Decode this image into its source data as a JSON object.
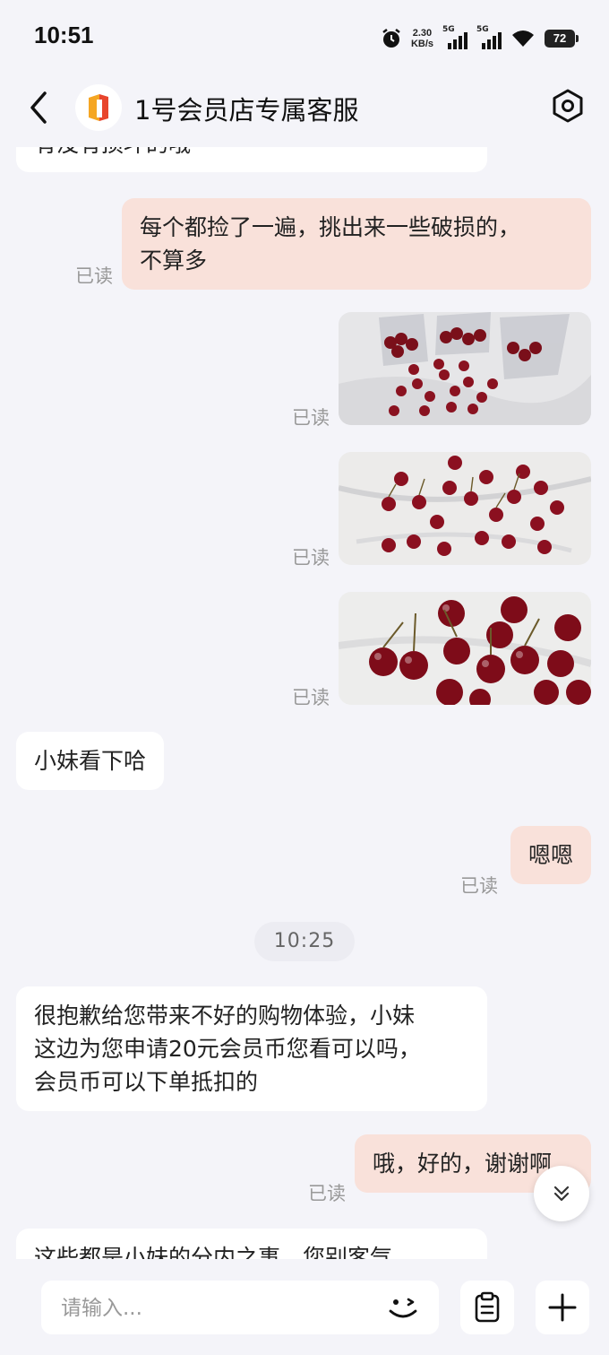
{
  "status_bar": {
    "time": "10:51",
    "net_speed_value": "2.30",
    "net_speed_unit": "KB/s",
    "sim1": "5G",
    "sim2": "5G",
    "battery": "72"
  },
  "header": {
    "title": "1号会员店专属客服"
  },
  "messages": [
    {
      "side": "in",
      "text": "有没有损坏的哦"
    },
    {
      "side": "out",
      "text_line1": "每个都捡了一遍，挑出来一些破损的，",
      "text_line2": "不算多",
      "status": "已读"
    },
    {
      "side": "out",
      "type": "image",
      "content": "cherries with plastic bags",
      "status": "已读"
    },
    {
      "side": "out",
      "type": "image",
      "content": "cherries on marble",
      "status": "已读"
    },
    {
      "side": "out",
      "type": "image",
      "content": "cherries close-up",
      "status": "已读"
    },
    {
      "side": "in",
      "text": "小妹看下哈"
    },
    {
      "side": "out",
      "text": "嗯嗯",
      "status": "已读"
    },
    {
      "type": "timestamp",
      "text": "10:25"
    },
    {
      "side": "in",
      "text_line1": "很抱歉给您带来不好的购物体验，小妹",
      "text_line2": "这边为您申请20元会员币您看可以吗，",
      "text_line3": "会员币可以下单抵扣的"
    },
    {
      "side": "out",
      "text": "哦，好的，谢谢啊",
      "status": "已读"
    },
    {
      "side": "in",
      "text": "这些都是小妹的分内之事，您别客气"
    }
  ],
  "input": {
    "placeholder": "请输入..."
  },
  "icons": {
    "back": "chevron-left-icon",
    "settings": "hexagon-gear-icon",
    "emoji": "wink-face-icon",
    "clipboard": "clipboard-icon",
    "plus": "plus-icon",
    "scroll_down": "double-chevron-down-icon"
  },
  "colors": {
    "background": "#f4f4f9",
    "incoming_bubble": "#ffffff",
    "outgoing_bubble": "#f9e1da",
    "read_status": "#999999"
  }
}
